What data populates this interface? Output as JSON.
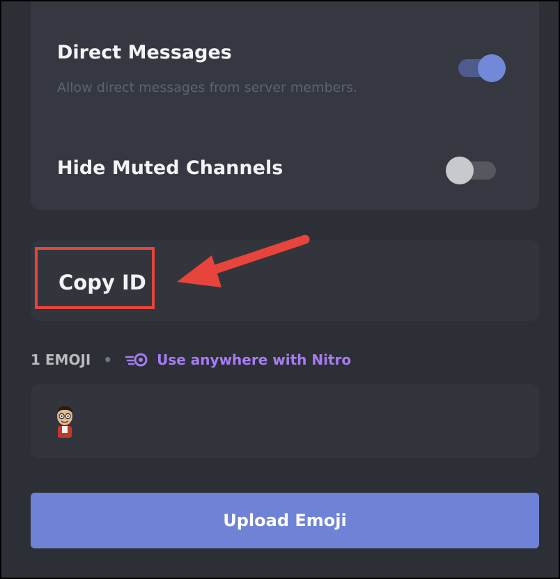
{
  "settings": {
    "direct_messages": {
      "title": "Direct Messages",
      "description": "Allow direct messages from server members.",
      "enabled": true
    },
    "hide_muted": {
      "title": "Hide Muted Channels",
      "enabled": false
    }
  },
  "copy_id": {
    "label": "Copy ID"
  },
  "emoji_section": {
    "count_label": "1 EMOJI",
    "separator": "•",
    "nitro_label": "Use anywhere with Nitro"
  },
  "emoji_list": {
    "items": [
      "custom-emoji-avatar"
    ]
  },
  "upload_button": {
    "label": "Upload Emoji"
  },
  "colors": {
    "background": "#2c2f36",
    "card": "#353840",
    "toggle_on": "#7289da",
    "toggle_off": "#b9bbbe",
    "highlight": "#e8443c",
    "nitro": "#a77cf2",
    "button": "#6f83d6"
  },
  "icons": {
    "nitro": "nitro-icon",
    "annotation_arrow": "arrow-icon"
  }
}
